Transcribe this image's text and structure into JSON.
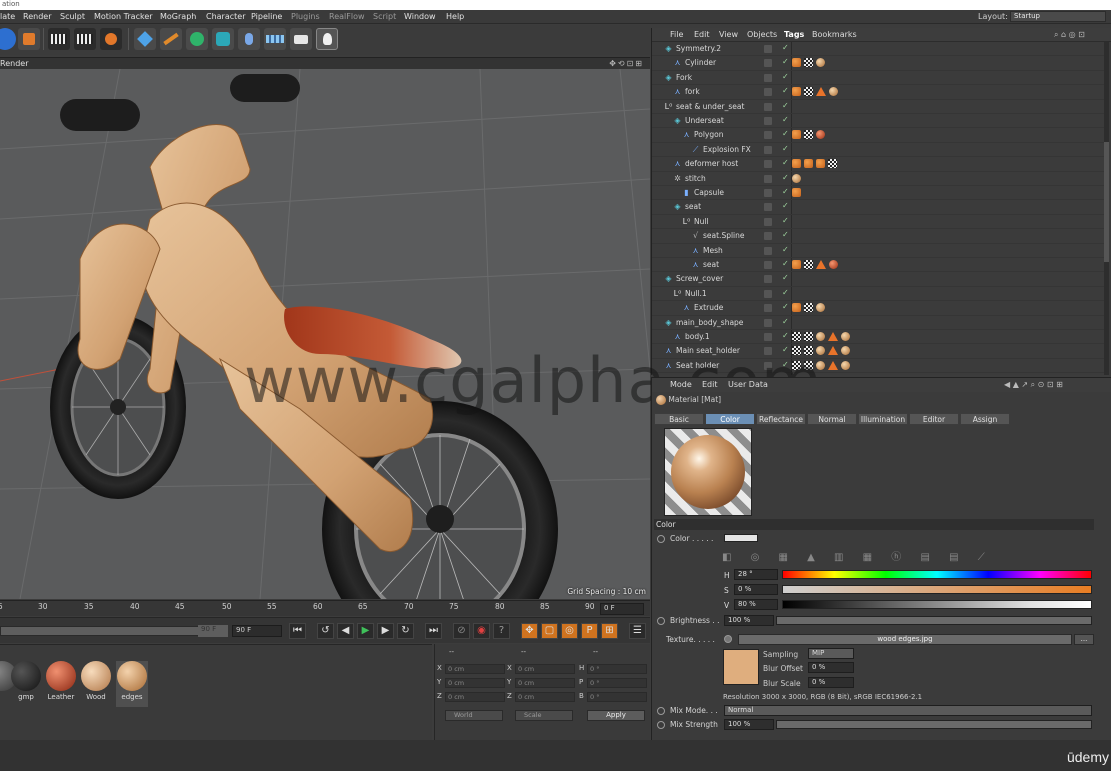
{
  "window": {
    "title_fragment": "ation"
  },
  "menu": {
    "items": [
      "late",
      "Render",
      "Sculpt",
      "Motion Tracker",
      "MoGraph",
      "Character",
      "Pipeline",
      "Plugins",
      "RealFlow",
      "Script",
      "Window",
      "Help"
    ],
    "layout_label": "Layout:",
    "layout_value": "Startup"
  },
  "viewport": {
    "header": "Render",
    "grid_spacing": "Grid Spacing : 10 cm"
  },
  "timeline": {
    "ticks": [
      "0",
      "5",
      "30",
      "35",
      "40",
      "45",
      "50",
      "55",
      "60",
      "65",
      "70",
      "75",
      "80",
      "85",
      "90"
    ],
    "frame_field": "0 F",
    "end_frame": "90 F",
    "end_field": "90 F"
  },
  "materials": [
    {
      "label": "",
      "color": "#555555"
    },
    {
      "label": "gmp",
      "color": "#2a2a2a"
    },
    {
      "label": "Leather",
      "color": "#a33218"
    },
    {
      "label": "Wood",
      "color": "#d9a679"
    },
    {
      "label": "edges",
      "color": "#d7a06a"
    }
  ],
  "coordinates": {
    "headers": [
      "--",
      "--",
      "--"
    ],
    "rows": [
      {
        "axis1": "X",
        "v1": "0 cm",
        "axis2": "X",
        "v2": "0 cm",
        "axis3": "H",
        "v3": "0 °"
      },
      {
        "axis1": "Y",
        "v1": "0 cm",
        "axis2": "Y",
        "v2": "0 cm",
        "axis3": "P",
        "v3": "0 °"
      },
      {
        "axis1": "Z",
        "v1": "0 cm",
        "axis2": "Z",
        "v2": "0 cm",
        "axis3": "B",
        "v3": "0 °"
      }
    ],
    "dropdown1": "World",
    "dropdown2": "Scale",
    "apply_label": "Apply"
  },
  "object_manager": {
    "menu": [
      "File",
      "Edit",
      "View",
      "Objects",
      "Tags",
      "Bookmarks"
    ],
    "objects": [
      {
        "name": "Symmetry.2",
        "indent": 0,
        "icon": "◈",
        "icon_color": "#5ac8d8",
        "tags": []
      },
      {
        "name": "Cylinder",
        "indent": 1,
        "icon": "⋏",
        "icon_color": "#7ab0ff",
        "tags": [
          "orange",
          "check",
          "ball"
        ]
      },
      {
        "name": "Fork",
        "indent": 0,
        "icon": "◈",
        "icon_color": "#5ac8d8",
        "tags": []
      },
      {
        "name": "fork",
        "indent": 1,
        "icon": "⋏",
        "icon_color": "#7ab0ff",
        "tags": [
          "orange",
          "check",
          "warn",
          "ball"
        ]
      },
      {
        "name": "seat & under_seat",
        "indent": 0,
        "icon": "L⁰",
        "icon_color": "#dddddd",
        "tags": []
      },
      {
        "name": "Underseat",
        "indent": 1,
        "icon": "◈",
        "icon_color": "#5ac8d8",
        "tags": []
      },
      {
        "name": "Polygon",
        "indent": 2,
        "icon": "⋏",
        "icon_color": "#7ab0ff",
        "tags": [
          "orange",
          "check",
          "ballred"
        ]
      },
      {
        "name": "Explosion FX",
        "indent": 3,
        "icon": "⟋",
        "icon_color": "#7ab0ff",
        "tags": []
      },
      {
        "name": "deformer host",
        "indent": 1,
        "icon": "⋏",
        "icon_color": "#7ab0ff",
        "tags": [
          "orange",
          "orange",
          "orange",
          "check"
        ]
      },
      {
        "name": "stitch",
        "indent": 1,
        "icon": "✲",
        "icon_color": "#bbbbbb",
        "tags": [
          "ball"
        ]
      },
      {
        "name": "Capsule",
        "indent": 2,
        "icon": "▮",
        "icon_color": "#7ab0ff",
        "tags": [
          "orange"
        ]
      },
      {
        "name": "seat",
        "indent": 1,
        "icon": "◈",
        "icon_color": "#5ac8d8",
        "tags": []
      },
      {
        "name": "Null",
        "indent": 2,
        "icon": "L⁰",
        "icon_color": "#dddddd",
        "tags": []
      },
      {
        "name": "seat.Spline",
        "indent": 3,
        "icon": "√",
        "icon_color": "#bbbbbb",
        "tags": []
      },
      {
        "name": "Mesh",
        "indent": 3,
        "icon": "⋏",
        "icon_color": "#7ab0ff",
        "tags": []
      },
      {
        "name": "seat",
        "indent": 3,
        "icon": "⋏",
        "icon_color": "#7ab0ff",
        "tags": [
          "orange",
          "check",
          "warn",
          "ballred"
        ]
      },
      {
        "name": "Screw_cover",
        "indent": 0,
        "icon": "◈",
        "icon_color": "#5ac8d8",
        "tags": []
      },
      {
        "name": "Null.1",
        "indent": 1,
        "icon": "L⁰",
        "icon_color": "#dddddd",
        "tags": []
      },
      {
        "name": "Extrude",
        "indent": 2,
        "icon": "⋏",
        "icon_color": "#7ab0ff",
        "tags": [
          "orange",
          "check",
          "ball"
        ]
      },
      {
        "name": "main_body_shape",
        "indent": 0,
        "icon": "◈",
        "icon_color": "#5ac8d8",
        "tags": []
      },
      {
        "name": "body.1",
        "indent": 1,
        "icon": "⋏",
        "icon_color": "#7ab0ff",
        "tags": [
          "check",
          "check",
          "ball",
          "warn",
          "ball"
        ]
      },
      {
        "name": "Main seat_holder",
        "indent": 0,
        "icon": "⋏",
        "icon_color": "#7ab0ff",
        "tags": [
          "check",
          "check",
          "ball",
          "warn",
          "ball"
        ]
      },
      {
        "name": "Seat holder",
        "indent": 0,
        "icon": "⋏",
        "icon_color": "#7ab0ff",
        "tags": [
          "check",
          "check",
          "ball",
          "warn",
          "ball"
        ]
      }
    ]
  },
  "attribute_manager": {
    "menu": [
      "Mode",
      "Edit",
      "User Data"
    ],
    "title": "Material [Mat]",
    "tabs": [
      "Basic",
      "Color",
      "Reflectance",
      "Normal",
      "Illumination",
      "Editor",
      "Assign"
    ],
    "active_tab": "Color",
    "section": "Color",
    "color_label": "Color . . . . .",
    "h_label": "H",
    "h_value": "28 °",
    "s_label": "S",
    "s_value": "0 %",
    "v_label": "V",
    "v_value": "80 %",
    "brightness_label": "Brightness . .",
    "brightness_value": "100 %",
    "texture_label": "Texture. . . . .",
    "texture_file": "wood edges.jpg",
    "texture_more": "...",
    "sampling_label": "Sampling",
    "sampling_value": "MIP",
    "blur_offset_label": "Blur Offset",
    "blur_offset_value": "0 %",
    "blur_scale_label": "Blur Scale",
    "blur_scale_value": "0 %",
    "resolution": "Resolution 3000 x 3000, RGB (8 Bit), sRGB IEC61966-2.1",
    "mix_mode_label": "Mix Mode. . .",
    "mix_mode_value": "Normal",
    "mix_strength_label": "Mix Strength",
    "mix_strength_value": "100 %"
  },
  "watermark": "www.cgalpha.com",
  "branding": "ūdemy"
}
